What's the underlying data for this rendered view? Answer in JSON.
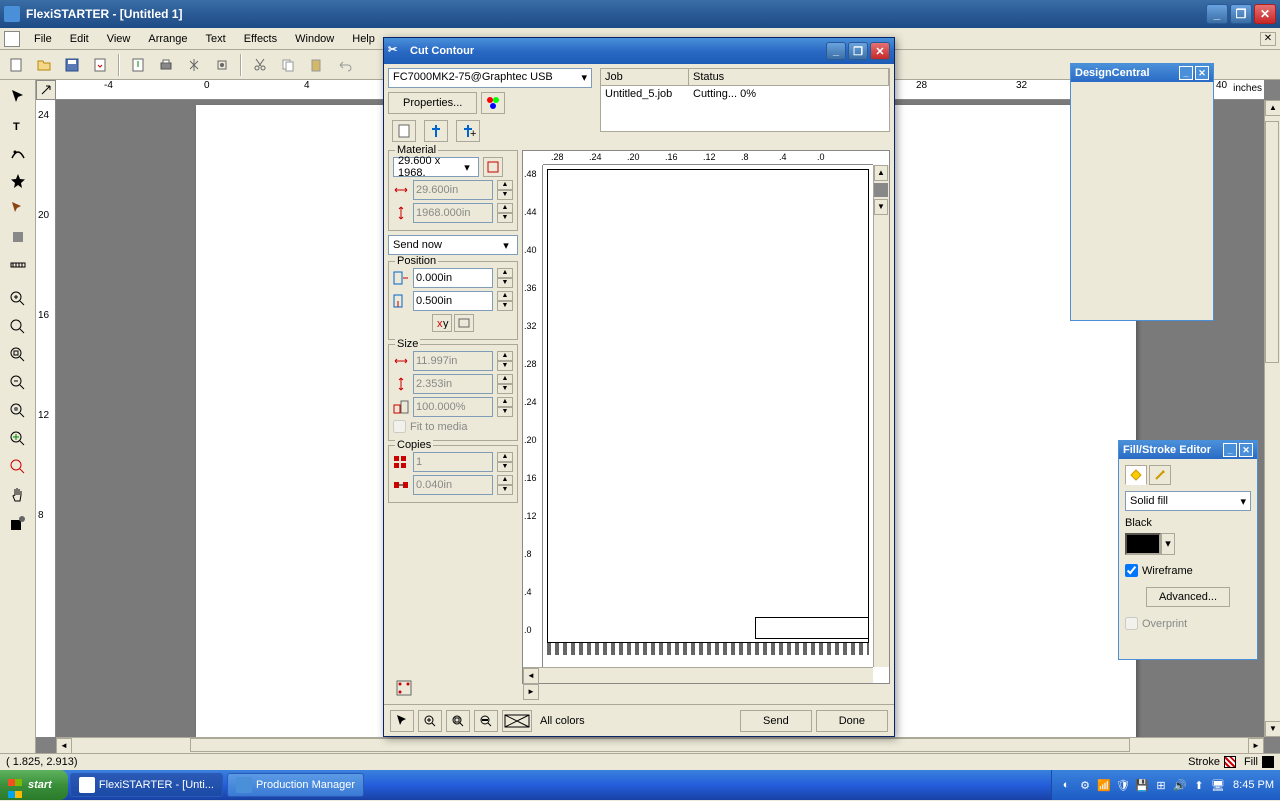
{
  "app": {
    "title": "FlexiSTARTER - [Untitled 1]"
  },
  "menu": {
    "file": "File",
    "edit": "Edit",
    "view": "View",
    "arrange": "Arrange",
    "text": "Text",
    "effects": "Effects",
    "window": "Window",
    "help": "Help"
  },
  "ruler": {
    "unit": "inches",
    "h_labels": [
      "-4",
      "0",
      "4",
      "28",
      "32",
      "40"
    ],
    "v_labels": [
      "24",
      "20",
      "16",
      "12",
      "8"
    ]
  },
  "status": {
    "coords": "( 1.825,     2.913)",
    "stroke_label": "Stroke",
    "fill_label": "Fill"
  },
  "taskbar": {
    "start": "start",
    "items": [
      "FlexiSTARTER - [Unti...",
      "Production Manager"
    ],
    "clock": "8:45 PM"
  },
  "cut_contour": {
    "title": "Cut Contour",
    "device": "FC7000MK2-75@Graphtec USB",
    "properties_btn": "Properties...",
    "job_header_job": "Job",
    "job_header_status": "Status",
    "job_name": "Untitled_5.job",
    "job_status": "Cutting... 0%",
    "material_label": "Material",
    "material_size": "29.600 x 1968.",
    "material_w": "29.600in",
    "material_h": "1968.000in",
    "send_mode": "Send now",
    "position_label": "Position",
    "pos_x": "0.000in",
    "pos_y": "0.500in",
    "size_label": "Size",
    "size_w": "11.997in",
    "size_h": "2.353in",
    "size_pct": "100.000%",
    "fit_media": "Fit to media",
    "copies_label": "Copies",
    "copies_n": "1",
    "copies_gap": "0.040in",
    "all_colors": "All colors",
    "send_btn": "Send",
    "done_btn": "Done",
    "preview_h_labels": [
      ".28",
      ".24",
      ".20",
      ".16",
      ".12",
      ".8",
      ".4",
      ".0"
    ],
    "preview_v_labels": [
      ".48",
      ".44",
      ".40",
      ".36",
      ".32",
      ".28",
      ".24",
      ".20",
      ".16",
      ".12",
      ".8",
      ".4",
      ".0"
    ]
  },
  "design_central": {
    "title": "DesignCentral"
  },
  "fill_stroke": {
    "title": "Fill/Stroke Editor",
    "fill_type": "Solid fill",
    "color_name": "Black",
    "wireframe": "Wireframe",
    "advanced": "Advanced...",
    "overprint": "Overprint"
  }
}
